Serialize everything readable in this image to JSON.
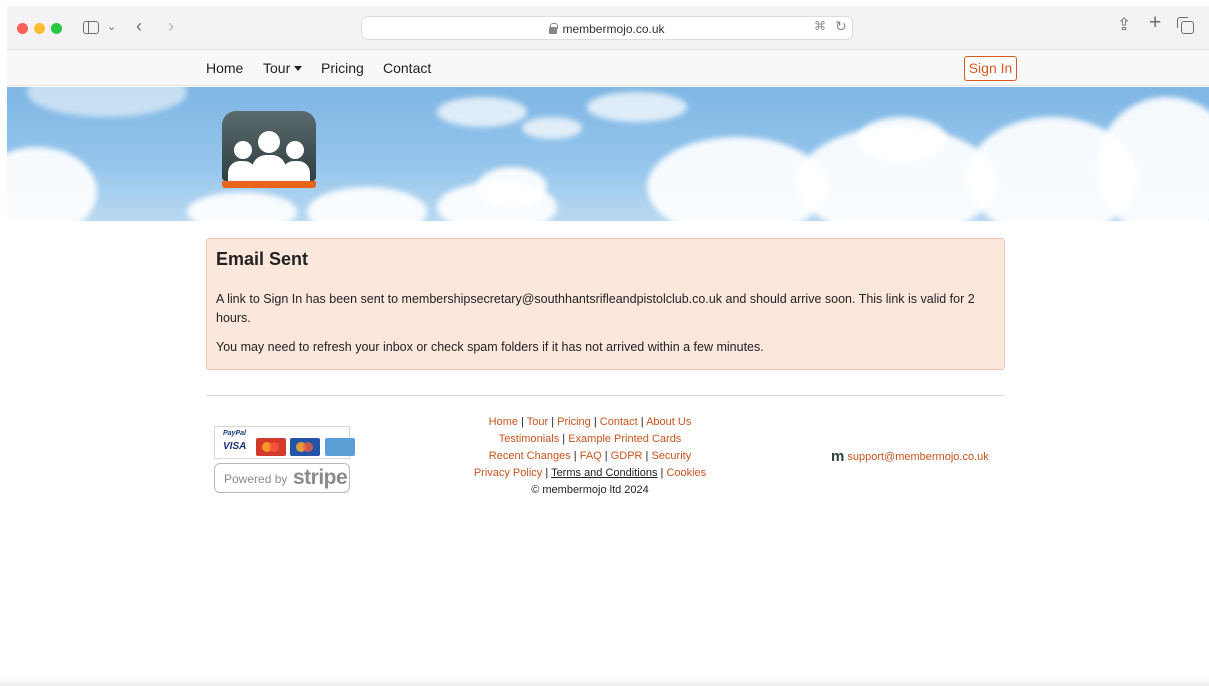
{
  "browser": {
    "url": "membermojo.co.uk",
    "icons": [
      "sidebar-icon",
      "chevron-down-icon",
      "back-icon",
      "forward-icon",
      "lock-icon",
      "translate-icon",
      "reload-icon",
      "share-icon",
      "plus-icon",
      "tabs-icon"
    ]
  },
  "nav": {
    "home": "Home",
    "tour": "Tour",
    "pricing": "Pricing",
    "contact": "Contact",
    "sign_in": "Sign In"
  },
  "alert": {
    "title": "Email Sent",
    "message": "A link to Sign In has been sent to membershipsecretary@southhantsrifleandpistolclub.co.uk and should arrive soon. This link is valid for 2 hours.",
    "hint": "You may need to refresh your inbox or check spam folders if it has not arrived within a few minutes."
  },
  "footer": {
    "paypal": "PayPal",
    "visa": "VISA",
    "powered_by": "Powered by",
    "stripe": "stripe",
    "links": {
      "home": "Home",
      "tour": "Tour",
      "pricing": "Pricing",
      "contact": "Contact",
      "about": "About Us",
      "testimonials": "Testimonials",
      "example_cards": "Example Printed Cards",
      "recent_changes": "Recent Changes",
      "faq": "FAQ",
      "gdpr": "GDPR",
      "security": "Security",
      "privacy": "Privacy Policy",
      "terms": "Terms and Conditions",
      "cookies": "Cookies"
    },
    "copyright": "© membermojo ltd 2024",
    "support_logo": "m",
    "support_email": "support@membermojo.co.uk"
  },
  "colors": {
    "accent": "#d9581c",
    "alert_bg": "#fce7dd",
    "logo_dark": "#2f3e41",
    "logo_bar": "#e8631b"
  }
}
